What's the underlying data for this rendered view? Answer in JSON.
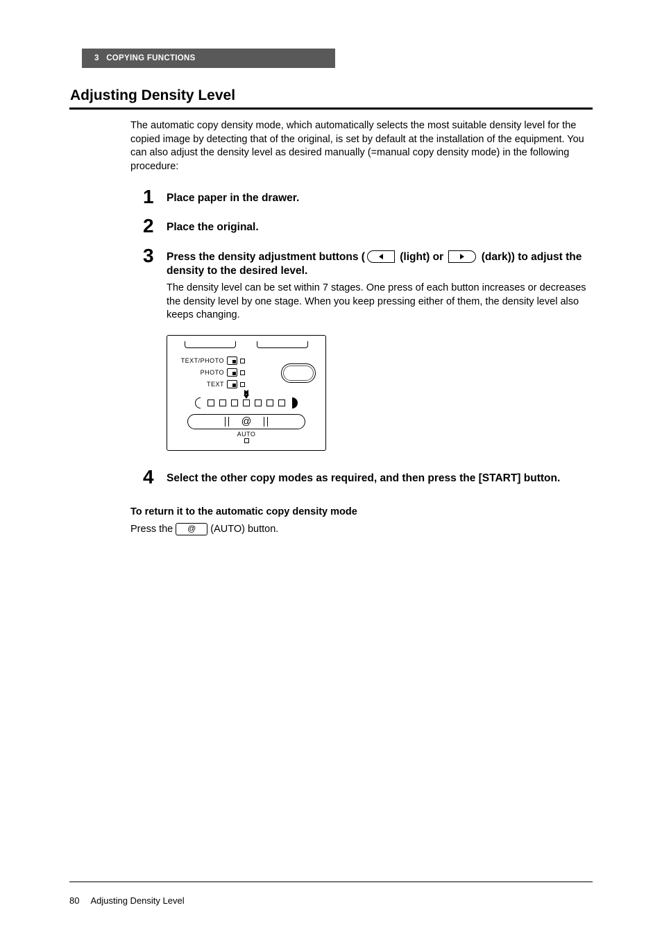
{
  "chapter": {
    "number": "3",
    "title": "COPYING FUNCTIONS"
  },
  "heading": "Adjusting Density Level",
  "intro": "The automatic copy density mode, which automatically selects the most suitable density level for the copied image by detecting that of the original, is set by default at the installation of the equipment. You can also adjust the density level as desired manually (=manual copy density mode) in the following procedure:",
  "steps": {
    "1": {
      "text": "Place paper in the drawer."
    },
    "2": {
      "text": "Place the original."
    },
    "3": {
      "pre": "Press the density adjustment buttons (",
      "mid1": " (light) or ",
      "mid2": " (dark)) to adjust the density to the desired level.",
      "desc": "The density level can be set within 7 stages. One press of each button increases or decreases the density level by one stage. When you keep pressing either of them, the density level also keeps changing."
    },
    "4": {
      "text": "Select the other copy modes as required, and then press the [START] button."
    }
  },
  "panel": {
    "modes": {
      "text_photo": "TEXT/PHOTO",
      "photo": "PHOTO",
      "text": "TEXT"
    },
    "auto_label": "AUTO"
  },
  "return_mode": {
    "heading": "To return it to the automatic copy density mode",
    "pre": "Press the ",
    "post": " (AUTO) button.",
    "auto_glyph": "@"
  },
  "footer": {
    "page_number": "80",
    "title": "Adjusting Density Level"
  }
}
